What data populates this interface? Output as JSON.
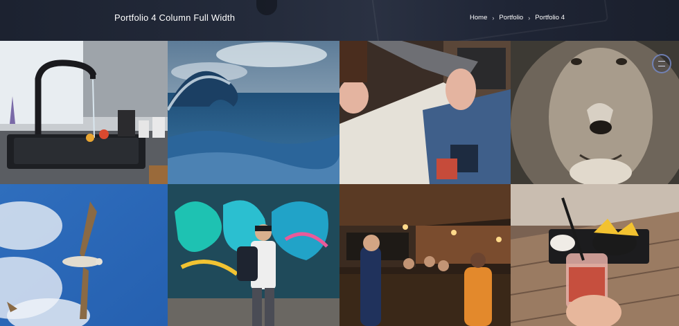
{
  "header": {
    "title": "Portfolio 4 Column Full Width",
    "breadcrumb": [
      {
        "label": "Home"
      },
      {
        "label": "Portfolio"
      },
      {
        "label": "Portfolio 4"
      }
    ],
    "separator": "›"
  },
  "portfolio": {
    "items": [
      {
        "subject": "kitchen sink with faucet"
      },
      {
        "subject": "ocean wave"
      },
      {
        "subject": "hands browsing vinyl records"
      },
      {
        "subject": "lion portrait"
      },
      {
        "subject": "seagull in blue sky"
      },
      {
        "subject": "man in front of graffiti wall"
      },
      {
        "subject": "crowded bar interior"
      },
      {
        "subject": "cocktail on wooden table"
      }
    ]
  },
  "colors": {
    "header_bg": "#232a3a",
    "text": "#ffffff",
    "accent_ring": "#7a8cc8"
  },
  "icons": {
    "breadcrumb_separator": "chevron-right-icon",
    "floating_button": "menu-icon"
  }
}
